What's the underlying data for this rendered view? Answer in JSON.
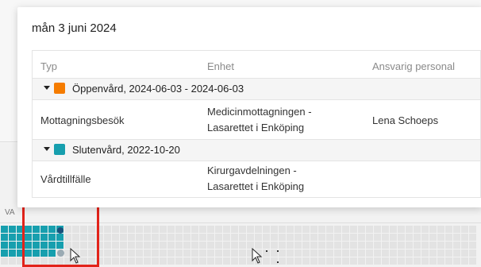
{
  "popup": {
    "title": "mån 3 juni 2024",
    "columns": [
      "Typ",
      "Enhet",
      "Ansvarig personal"
    ],
    "groups": [
      {
        "label": "Öppenvård, 2024-06-03 - 2024-06-03",
        "color": "#f57c00",
        "rows": [
          {
            "typ": "Mottagningsbesök",
            "enhet_line1": "Medicinmottagningen -",
            "enhet_line2": "Lasarettet i Enköping",
            "personal": "Lena Schoeps"
          }
        ]
      },
      {
        "label": "Slutenvård, 2022-10-20",
        "color": "#179fae",
        "rows": [
          {
            "typ": "Vårdtillfälle",
            "enhet_line1": "Kirurgavdelningen -",
            "enhet_line2": "Lasarettet i Enköping",
            "personal": ""
          }
        ]
      }
    ]
  },
  "background": {
    "row_label": "VA",
    "highlight_color": "#e2231a"
  }
}
